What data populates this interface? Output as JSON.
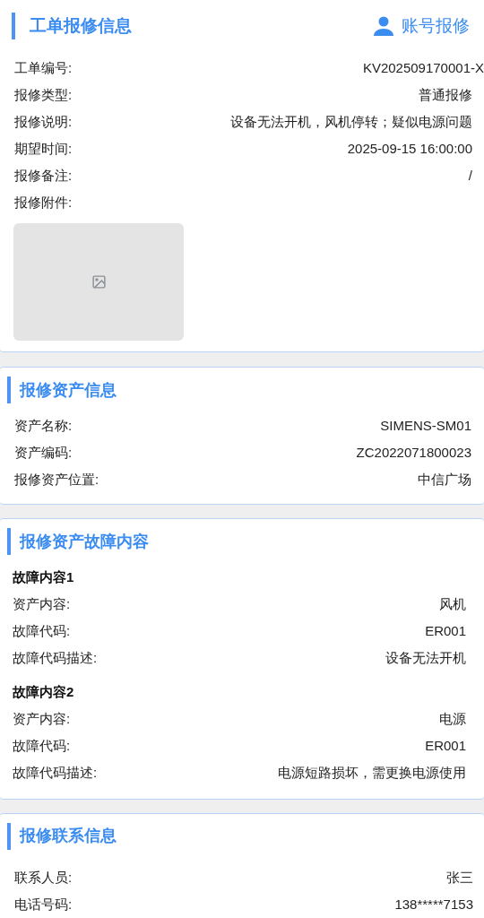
{
  "order_section": {
    "title": "工单报修信息",
    "action": "账号报修",
    "fields": [
      {
        "label": "工单编号:",
        "value": "KV202509170001-X"
      },
      {
        "label": "报修类型:",
        "value": "普通报修"
      },
      {
        "label": "报修说明:",
        "value": "设备无法开机，风机停转；疑似电源问题"
      },
      {
        "label": "期望时间:",
        "value": "2025-09-15 16:00:00"
      },
      {
        "label": "报修备注:",
        "value": "/"
      },
      {
        "label": "报修附件:"
      }
    ],
    "attachments": [
      {
        "kind": "placeholder"
      }
    ]
  },
  "asset_section": {
    "title": "报修资产信息",
    "fields": [
      {
        "label": "资产名称:",
        "value": "SIMENS-SM01"
      },
      {
        "label": "资产编码:",
        "value": "ZC2022071800023"
      },
      {
        "label": "报修资产位置:",
        "value": "中信广场"
      }
    ]
  },
  "fault_section": {
    "title": "报修资产故障内容",
    "groups": [
      {
        "title": "故障内容1",
        "fields": [
          {
            "label": "资产内容:",
            "value": "风机"
          },
          {
            "label": "故障代码:",
            "value": "ER001"
          },
          {
            "label": "故障代码描述:",
            "value": "设备无法开机"
          }
        ]
      },
      {
        "title": "故障内容2",
        "fields": [
          {
            "label": "资产内容:",
            "value": "电源"
          },
          {
            "label": "故障代码:",
            "value": "ER001"
          },
          {
            "label": "故障代码描述:",
            "value": "电源短路损坏，需更换电源使用"
          }
        ]
      }
    ]
  },
  "contact_section": {
    "title": "报修联系信息",
    "fields": [
      {
        "label": "联系人员:",
        "value": "张三"
      },
      {
        "label": "电话号码:",
        "value": "138*****7153"
      }
    ]
  }
}
